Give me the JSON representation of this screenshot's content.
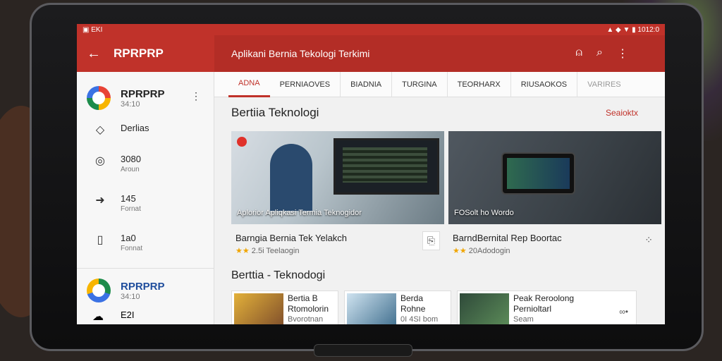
{
  "status": {
    "left": "▣ EKI",
    "right": "▲ ◆ ▼ ▮ 1012:0"
  },
  "app": {
    "title": "RPRPRP",
    "page_title": "Aplikani Bernia Tekologi Terkimi"
  },
  "account": {
    "name": "RPRPRP",
    "sub": "34:10"
  },
  "nav": [
    {
      "label": "Derlias",
      "sub": ""
    },
    {
      "label": "3080",
      "sub": "Aroun"
    },
    {
      "label": "145",
      "sub": "Fornat"
    },
    {
      "label": "1a0",
      "sub": "Fonnat"
    }
  ],
  "account2": {
    "name": "RPRPRP",
    "sub": "34:10"
  },
  "nav_last": {
    "label": "E2I"
  },
  "tabs": [
    "ADNA",
    "PERNIAOVES",
    "BIADNIA",
    "TURGINA",
    "TEORHARX",
    "RIUSAOKOS",
    "VARIRES"
  ],
  "section1": {
    "title": "Bertiia Teknologi",
    "link": "Seaioktx"
  },
  "cards": [
    {
      "caption": "Aplorior Apliqkasi Termia Teknogidor",
      "title": "Barngia Bernia Tek Yelakch",
      "rating": "2.5i Teelaogin"
    },
    {
      "caption": "FOSolt ho Wordo",
      "title": "BarndBernital Rep Boortac",
      "rating": "20Adodogin"
    }
  ],
  "section2": {
    "title": "Berttia - Teknodogi"
  },
  "list": [
    {
      "title": "Bertia B",
      "title2": "Rtomolorin",
      "sub": "Bvorotnan"
    },
    {
      "title": "Berda",
      "title2": "Rohne",
      "sub": "0I 4SI bom"
    },
    {
      "title": "Peak Reroolong",
      "title2": "Pernioltarl",
      "sub": "Seam"
    }
  ],
  "icons": {
    "back": "arrow-left-icon",
    "person": "person-icon",
    "search": "search-icon",
    "more": "more-vert-icon"
  },
  "colors": {
    "accent": "#c0322a"
  }
}
